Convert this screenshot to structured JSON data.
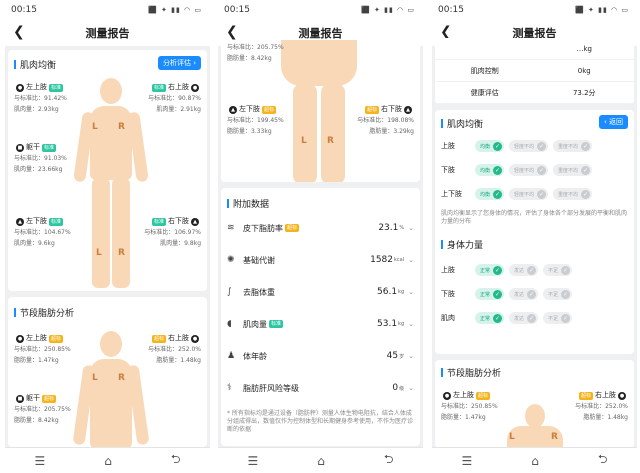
{
  "status": {
    "time": "00:15",
    "icons": "⬛ ✦ ▮▮ ◠ ▭"
  },
  "header": {
    "title": "测量报告",
    "back_glyph": "❮"
  },
  "nav": {
    "menu": "☰",
    "home": "⌂",
    "back": "⮌"
  },
  "colors": {
    "accent": "#1a8cff",
    "skin": "#f9d8b7",
    "ok": "#2ec5a0",
    "warn": "#f5b31c"
  },
  "body_letters": {
    "left": "L",
    "right": "R"
  },
  "muscle_balance": {
    "title": "肌肉均衡",
    "analyze_btn": "分析评估 ›",
    "left_arm": {
      "name": "左上肢",
      "ratio": "与标准比：91.42%",
      "mass": "肌肉量：2.93kg"
    },
    "right_arm": {
      "name": "右上肢",
      "ratio": "与标准比：90.87%",
      "mass": "肌肉量：2.91kg"
    },
    "trunk": {
      "name": "躯干",
      "ratio": "与标准比：91.03%",
      "mass": "肌肉量：23.66kg"
    },
    "left_leg": {
      "name": "左下肢",
      "ratio": "与标准比：104.67%",
      "mass": "肌肉量：9.6kg"
    },
    "right_leg": {
      "name": "右下肢",
      "ratio": "与标准比：106.97%",
      "mass": "肌肉量：9.8kg"
    },
    "tag_normal": "标准"
  },
  "fat_analysis": {
    "title": "节段脂肪分析",
    "left_arm": {
      "name": "左上肢",
      "ratio": "与标准比：250.85%",
      "mass": "脂肪量：1.47kg"
    },
    "right_arm": {
      "name": "右上肢",
      "ratio": "与标准比：252.0%",
      "mass": "脂肪量：1.48kg"
    },
    "trunk": {
      "name": "躯干",
      "ratio": "与标准比：205.75%",
      "mass": "脂肪量：8.42kg"
    },
    "left_leg": {
      "name": "左下肢",
      "ratio": "与标准比：199.45%",
      "mass": "脂肪量：3.33kg"
    },
    "right_leg": {
      "name": "右下肢",
      "ratio": "与标准比：198.08%",
      "mass": "脂肪量：3.29kg"
    },
    "tag_over": "超标"
  },
  "extra": {
    "title": "附加数据",
    "rows": [
      {
        "icon": "≋",
        "label": "皮下脂肪率",
        "tag": "超标",
        "value": "23.1",
        "unit": "%"
      },
      {
        "icon": "✺",
        "label": "基础代谢",
        "tag": "",
        "value": "1582",
        "unit": "kcal"
      },
      {
        "icon": "∫",
        "label": "去脂体重",
        "tag": "",
        "value": "56.1",
        "unit": "kg"
      },
      {
        "icon": "◖",
        "label": "肌肉量",
        "tag": "标准",
        "value": "53.1",
        "unit": "kg"
      },
      {
        "icon": "♟",
        "label": "体年龄",
        "tag": "",
        "value": "45",
        "unit": "岁"
      },
      {
        "icon": "⚕",
        "label": "脂肪肝风险等级",
        "tag": "",
        "value": "0",
        "unit": "级"
      }
    ],
    "note": "* 所有指标均是通过设备（脂肪秤）测量人体生物电阻抗，结合人体成分组成得出，数值仅作为控制体型和长期健身参考使用，不作为医疗诊断的依据"
  },
  "control": {
    "rows": [
      {
        "label": "",
        "value": "…kg"
      },
      {
        "label": "肌肉控制",
        "value": "0kg"
      },
      {
        "label": "健康评估",
        "value": "73.2分"
      }
    ]
  },
  "balance3": {
    "title": "肌肉均衡",
    "back_btn": "‹ 返回",
    "options": [
      "均衡",
      "轻度不均",
      "重度不均"
    ],
    "rows": [
      {
        "name": "上肢",
        "selected": 0
      },
      {
        "name": "下肢",
        "selected": 0
      },
      {
        "name": "上下肢",
        "selected": 0
      }
    ],
    "note": "肌肉均衡显示了您身体的情况，评估了身体各个部分发展的平衡和肌肉力量的分布"
  },
  "strength": {
    "title": "身体力量",
    "options": [
      "正常",
      "发达",
      "不足"
    ],
    "rows": [
      {
        "name": "上肢",
        "selected": 0
      },
      {
        "name": "下肢",
        "selected": 0
      },
      {
        "name": "肌肉",
        "selected": 0
      }
    ]
  }
}
